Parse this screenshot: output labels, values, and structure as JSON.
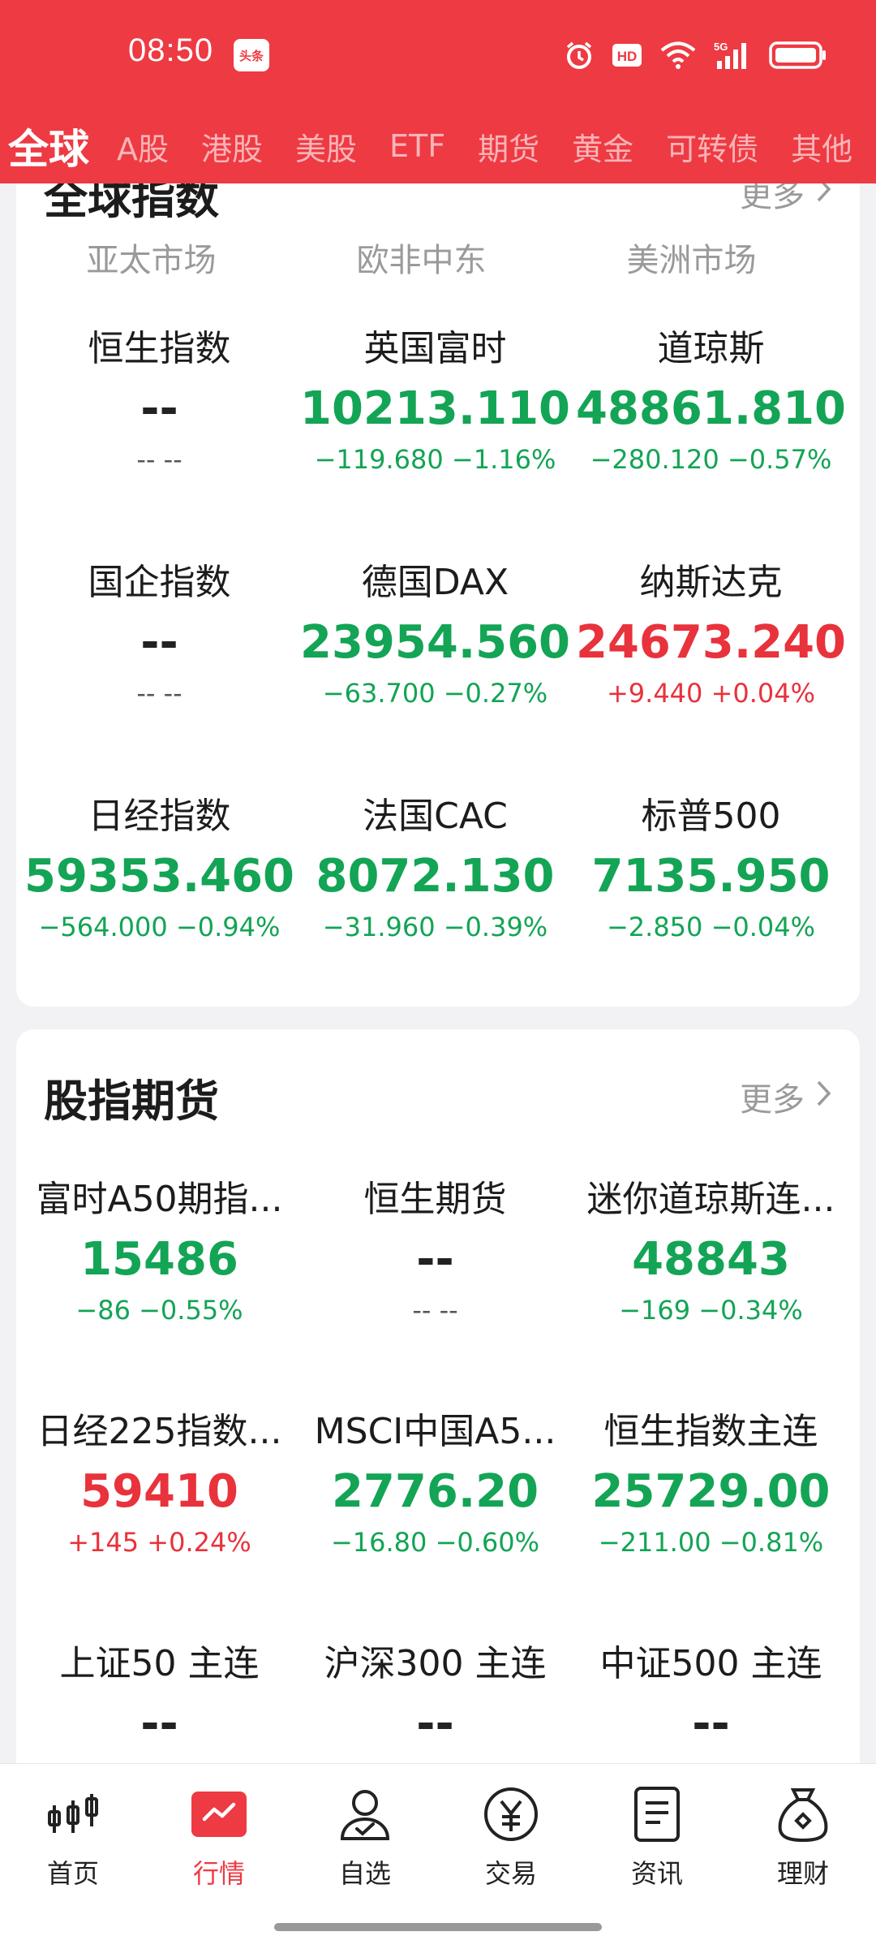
{
  "status_bar": {
    "time": "08:50",
    "app_badge": "头条",
    "icons": [
      "alarm-icon",
      "hd-icon",
      "wifi-icon",
      "5g-signal-icon",
      "battery-icon"
    ]
  },
  "tabs": [
    "全球",
    "A股",
    "港股",
    "美股",
    "ETF",
    "期货",
    "黄金",
    "可转债",
    "其他"
  ],
  "colors": {
    "brand": "#ee3a43",
    "up": "#e8323c",
    "down": "#13a455"
  },
  "global_indices": {
    "title": "全球指数",
    "more": "更多",
    "regions": [
      "亚太市场",
      "欧非中东",
      "美洲市场"
    ],
    "items": [
      {
        "name": "恒生指数",
        "price": "--",
        "change": "-- --",
        "trend": "flat"
      },
      {
        "name": "英国富时",
        "price": "10213.110",
        "change": "−119.680 −1.16%",
        "trend": "down"
      },
      {
        "name": "道琼斯",
        "price": "48861.810",
        "change": "−280.120 −0.57%",
        "trend": "down"
      },
      {
        "name": "国企指数",
        "price": "--",
        "change": "-- --",
        "trend": "flat"
      },
      {
        "name": "德国DAX",
        "price": "23954.560",
        "change": "−63.700 −0.27%",
        "trend": "down"
      },
      {
        "name": "纳斯达克",
        "price": "24673.240",
        "change": "+9.440 +0.04%",
        "trend": "up"
      },
      {
        "name": "日经指数",
        "price": "59353.460",
        "change": "−564.000 −0.94%",
        "trend": "down"
      },
      {
        "name": "法国CAC",
        "price": "8072.130",
        "change": "−31.960 −0.39%",
        "trend": "down"
      },
      {
        "name": "标普500",
        "price": "7135.950",
        "change": "−2.850 −0.04%",
        "trend": "down"
      }
    ]
  },
  "index_futures": {
    "title": "股指期货",
    "more": "更多",
    "items": [
      {
        "name": "富时A50期指...",
        "price": "15486",
        "change": "−86 −0.55%",
        "trend": "down"
      },
      {
        "name": "恒生期货",
        "price": "--",
        "change": "-- --",
        "trend": "flat"
      },
      {
        "name": "迷你道琼斯连...",
        "price": "48843",
        "change": "−169 −0.34%",
        "trend": "down"
      },
      {
        "name": "日经225指数...",
        "price": "59410",
        "change": "+145 +0.24%",
        "trend": "up"
      },
      {
        "name": "MSCI中国A5...",
        "price": "2776.20",
        "change": "−16.80 −0.60%",
        "trend": "down"
      },
      {
        "name": "恒生指数主连",
        "price": "25729.00",
        "change": "−211.00 −0.81%",
        "trend": "down"
      },
      {
        "name": "上证50 主连",
        "price": "--",
        "change": "",
        "trend": "flat"
      },
      {
        "name": "沪深300 主连",
        "price": "--",
        "change": "",
        "trend": "flat"
      },
      {
        "name": "中证500 主连",
        "price": "--",
        "change": "",
        "trend": "flat"
      }
    ]
  },
  "bottom_nav": [
    {
      "label": "首页",
      "icon": "candlestick-icon",
      "active": false
    },
    {
      "label": "行情",
      "icon": "chart-trend-icon",
      "active": true
    },
    {
      "label": "自选",
      "icon": "user-check-icon",
      "active": false
    },
    {
      "label": "交易",
      "icon": "yen-coin-icon",
      "active": false
    },
    {
      "label": "资讯",
      "icon": "document-icon",
      "active": false
    },
    {
      "label": "理财",
      "icon": "money-bag-icon",
      "active": false
    }
  ]
}
